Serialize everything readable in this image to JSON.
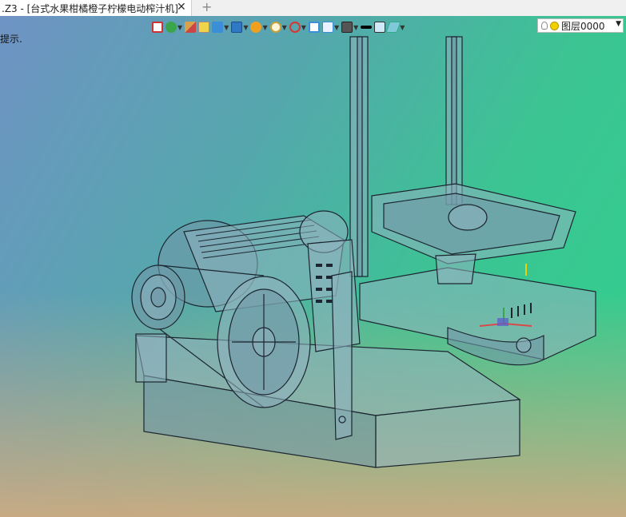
{
  "tab": {
    "title": ".Z3 - [台式水果柑橘橙子柠檬电动榨汁机]",
    "close_glyph": "✕",
    "new_glyph": "+"
  },
  "hint": "提示.",
  "toolbar": {
    "icons": [
      "import-icon",
      "pipe-icon",
      "brush-icon",
      "shade-icon",
      "cube-icon",
      "view-cube-icon",
      "render-sphere-icon",
      "zoom-icon",
      "axis-icon",
      "frame-icon",
      "copy-icon",
      "monitor-icon",
      "line-style-icon",
      "color-swatch-icon",
      "layer-stack-icon"
    ],
    "accent": "#2e7bd6"
  },
  "layer": {
    "label": "图层0000"
  },
  "colors": {
    "model_fill": "#8fb3bf",
    "edge": "#1c2630",
    "accent_yellow": "#f1d000"
  }
}
